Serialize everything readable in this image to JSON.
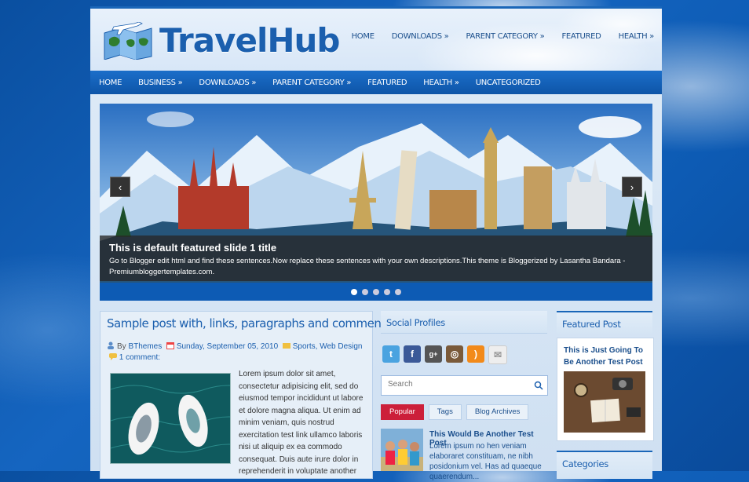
{
  "site": {
    "name": "TravelHub"
  },
  "top_nav": [
    {
      "label": "HOME"
    },
    {
      "label": "DOWNLOADS »"
    },
    {
      "label": "PARENT CATEGORY »"
    },
    {
      "label": "FEATURED"
    },
    {
      "label": "HEALTH »"
    }
  ],
  "main_nav": [
    {
      "label": "HOME"
    },
    {
      "label": "BUSINESS »"
    },
    {
      "label": "DOWNLOADS »"
    },
    {
      "label": "PARENT CATEGORY »"
    },
    {
      "label": "FEATURED"
    },
    {
      "label": "HEALTH »"
    },
    {
      "label": "UNCATEGORIZED"
    }
  ],
  "slider": {
    "title": "This is default featured slide 1 title",
    "description": "Go to Blogger edit html and find these sentences.Now replace these sentences with your own descriptions.This theme is Bloggerized by Lasantha Bandara - Premiumbloggertemplates.com.",
    "prev": "‹",
    "next": "›",
    "dot_count": 5,
    "active_dot": 1
  },
  "post": {
    "title": "Sample post with, links, paragraphs and comments",
    "author": "BThemes",
    "by_label": "By",
    "date": "Sunday, September 05, 2010",
    "categories": "Sports, Web Design",
    "comments": "1 comment:",
    "body": "Lorem ipsum dolor sit amet, consectetur adipisicing elit, sed do eiusmod tempor incididunt ut labore et dolore magna aliqua. Ut enim ad minim veniam, quis nostrud exercitation test link ullamco laboris nisi ut aliquip ex ea commodo consequat. Duis aute irure dolor in reprehenderit in voluptate another"
  },
  "social": {
    "title": "Social Profiles",
    "icons": [
      "twitter-icon",
      "facebook-icon",
      "google-plus-icon",
      "instagram-icon",
      "rss-icon",
      "email-icon"
    ]
  },
  "search": {
    "placeholder": "Search"
  },
  "tabs": [
    {
      "label": "Popular",
      "active": true
    },
    {
      "label": "Tags",
      "active": false
    },
    {
      "label": "Blog Archives",
      "active": false
    }
  ],
  "popular_post": {
    "title": "This Would Be Another Test Post",
    "text": "Lorem ipsum no hen veniam elaboraret constituam, ne nibh posidonium vel. Has ad quaeque quaerendum..."
  },
  "featured": {
    "title": "Featured Post",
    "post_title": "This is Just Going To Be Another Test Post"
  },
  "categories": {
    "title": "Categories"
  },
  "colors": {
    "accent": "#1b5fae",
    "nav": "#0e55a8",
    "active_tab": "#cc1f3a"
  }
}
